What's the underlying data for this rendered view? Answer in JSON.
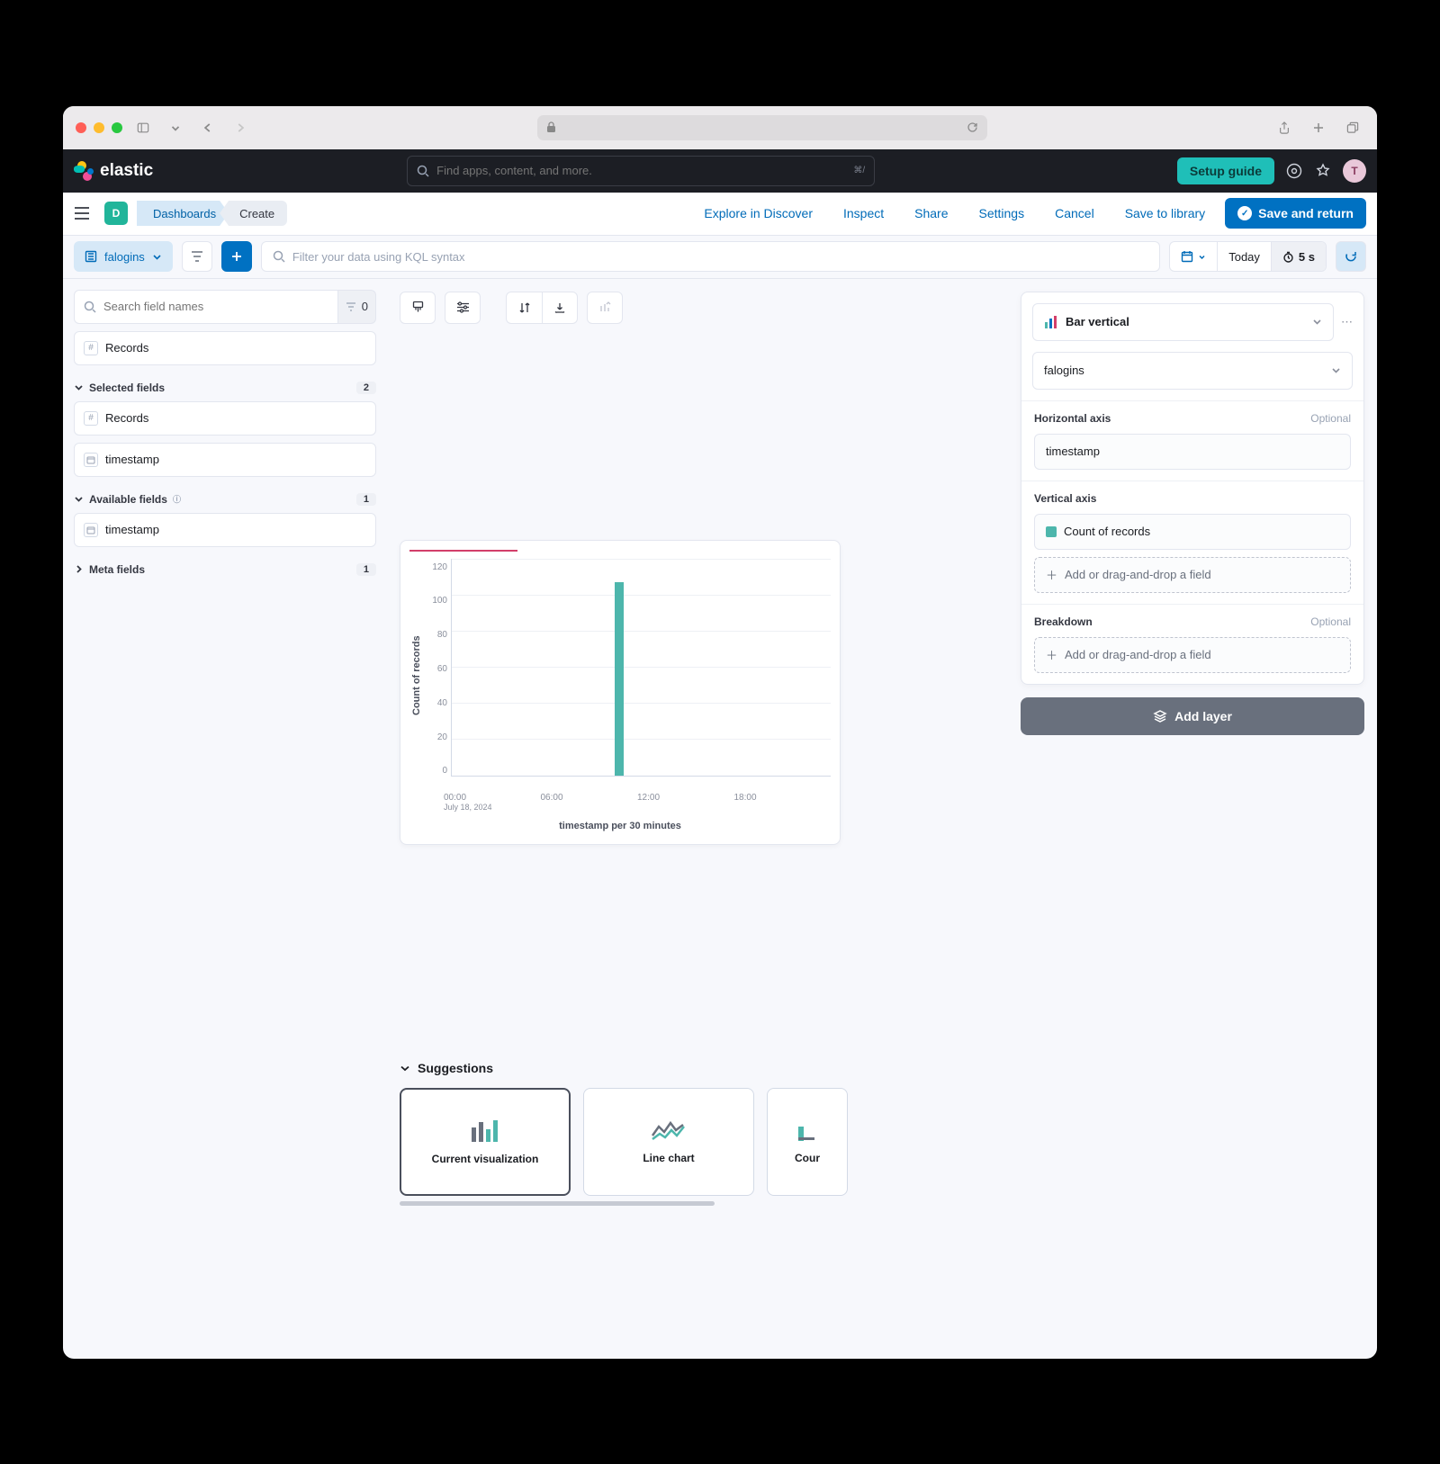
{
  "header": {
    "brand": "elastic",
    "search_placeholder": "Find apps, content, and more.",
    "search_kbd": "⌘/",
    "setup_guide": "Setup guide",
    "avatar_initial": "T"
  },
  "subheader": {
    "space_initial": "D",
    "breadcrumbs": [
      "Dashboards",
      "Create"
    ],
    "links": {
      "explore": "Explore in Discover",
      "inspect": "Inspect",
      "share": "Share",
      "settings": "Settings",
      "cancel": "Cancel",
      "save_lib": "Save to library",
      "save_return": "Save and return"
    }
  },
  "query": {
    "dataview": "falogins",
    "kql_placeholder": "Filter your data using KQL syntax",
    "today": "Today",
    "refresh": "5 s"
  },
  "fields": {
    "search_placeholder": "Search field names",
    "count": "0",
    "records": "Records",
    "selected": {
      "label": "Selected fields",
      "count": "2",
      "items": [
        "Records",
        "timestamp"
      ]
    },
    "available": {
      "label": "Available fields",
      "count": "1",
      "items": [
        "timestamp"
      ]
    },
    "meta": {
      "label": "Meta fields",
      "count": "1"
    }
  },
  "chart_data": {
    "type": "bar",
    "xlabel": "timestamp per 30 minutes",
    "ylabel": "Count of records",
    "ylim": [
      0,
      120
    ],
    "yticks": [
      0,
      20,
      40,
      60,
      80,
      100,
      120
    ],
    "xticks": [
      "00:00",
      "06:00",
      "12:00",
      "18:00"
    ],
    "xdate": "July 18, 2024",
    "series": [
      {
        "name": "Count of records",
        "x": "10:30",
        "value": 107
      }
    ]
  },
  "config": {
    "vis_type": "Bar vertical",
    "dataview": "falogins",
    "haxis": {
      "label": "Horizontal axis",
      "optional": "Optional",
      "field": "timestamp"
    },
    "vaxis": {
      "label": "Vertical axis",
      "field": "Count of records",
      "add": "Add or drag-and-drop a field"
    },
    "breakdown": {
      "label": "Breakdown",
      "optional": "Optional",
      "add": "Add or drag-and-drop a field"
    },
    "add_layer": "Add layer"
  },
  "suggestions": {
    "label": "Suggestions",
    "items": [
      "Current visualization",
      "Line chart",
      "Cour"
    ]
  }
}
